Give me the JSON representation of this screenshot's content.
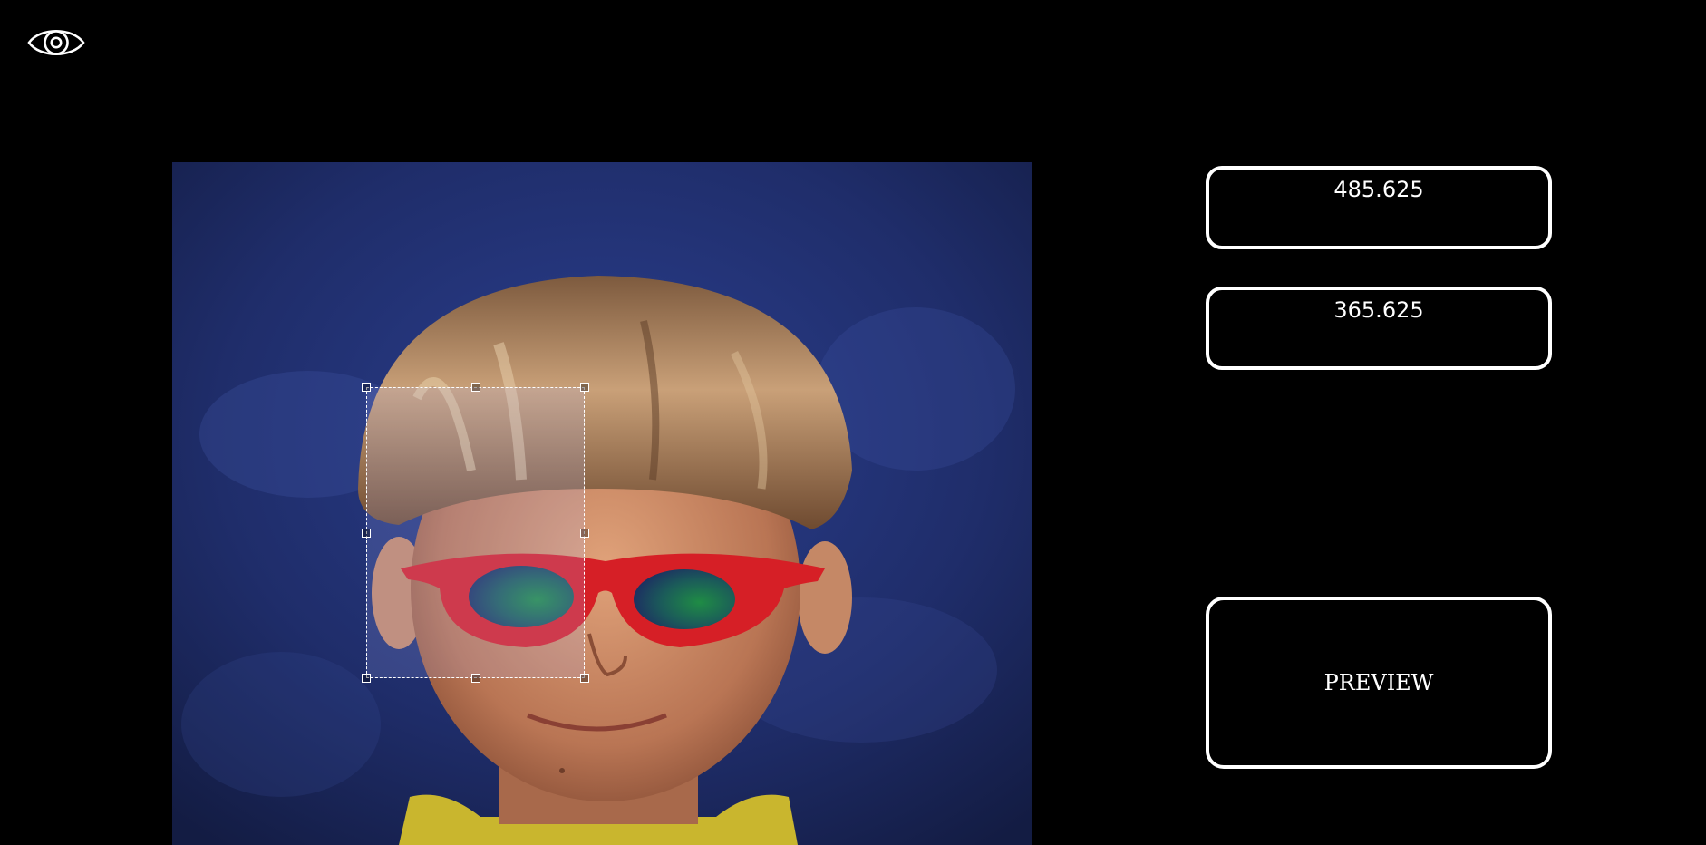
{
  "toolbar": {
    "visibility_icon": "eye-icon"
  },
  "editor": {
    "image_description_icon": "photo",
    "selection": "crop-selection"
  },
  "inputs": {
    "x_value": "485.625",
    "y_value": "365.625"
  },
  "actions": {
    "preview_label": "PREVIEW"
  },
  "colors": {
    "background": "#000000",
    "border": "#ffffff",
    "glasses": "#d61f26",
    "backdrop": "#1f2d6a"
  }
}
